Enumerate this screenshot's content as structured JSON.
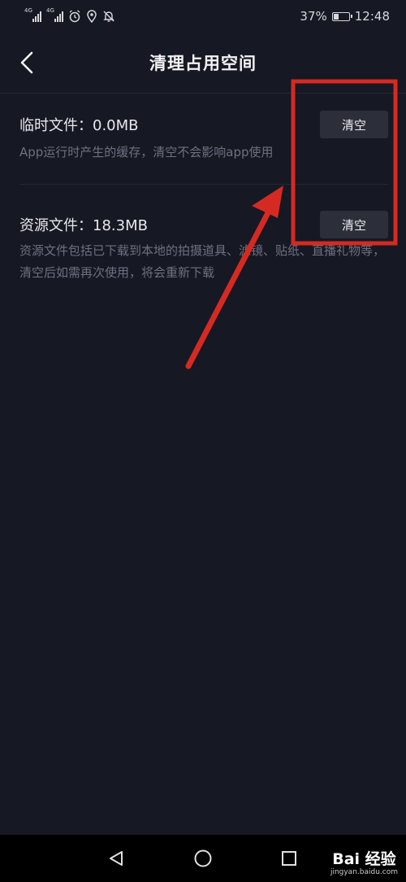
{
  "status_bar": {
    "network_1": "4G",
    "network_2": "4G",
    "battery": "37%",
    "battery_level": 0.37,
    "time": "12:48",
    "icons": [
      "signal-icon",
      "signal-icon",
      "alarm-icon",
      "location-icon",
      "mute-icon",
      "battery-icon"
    ]
  },
  "header": {
    "title": "清理占用空间"
  },
  "items": [
    {
      "title": "临时文件：0.0MB",
      "description": "App运行时产生的缓存，清空不会影响app使用",
      "button": "清空"
    },
    {
      "title": "资源文件：18.3MB",
      "description": "资源文件包括已下载到本地的拍摄道具、滤镜、贴纸、直播礼物等，清空后如需再次使用，将会重新下载",
      "button": "清空"
    }
  ],
  "nav_bar": {
    "icons": [
      "back-triangle-icon",
      "home-circle-icon",
      "recents-square-icon"
    ]
  },
  "watermark": {
    "main": "Bai 经验",
    "sub": "jingyan.baidu.com"
  },
  "colors": {
    "background": "#161823",
    "button_bg": "#2c2e39",
    "annotation": "#d42a22"
  }
}
